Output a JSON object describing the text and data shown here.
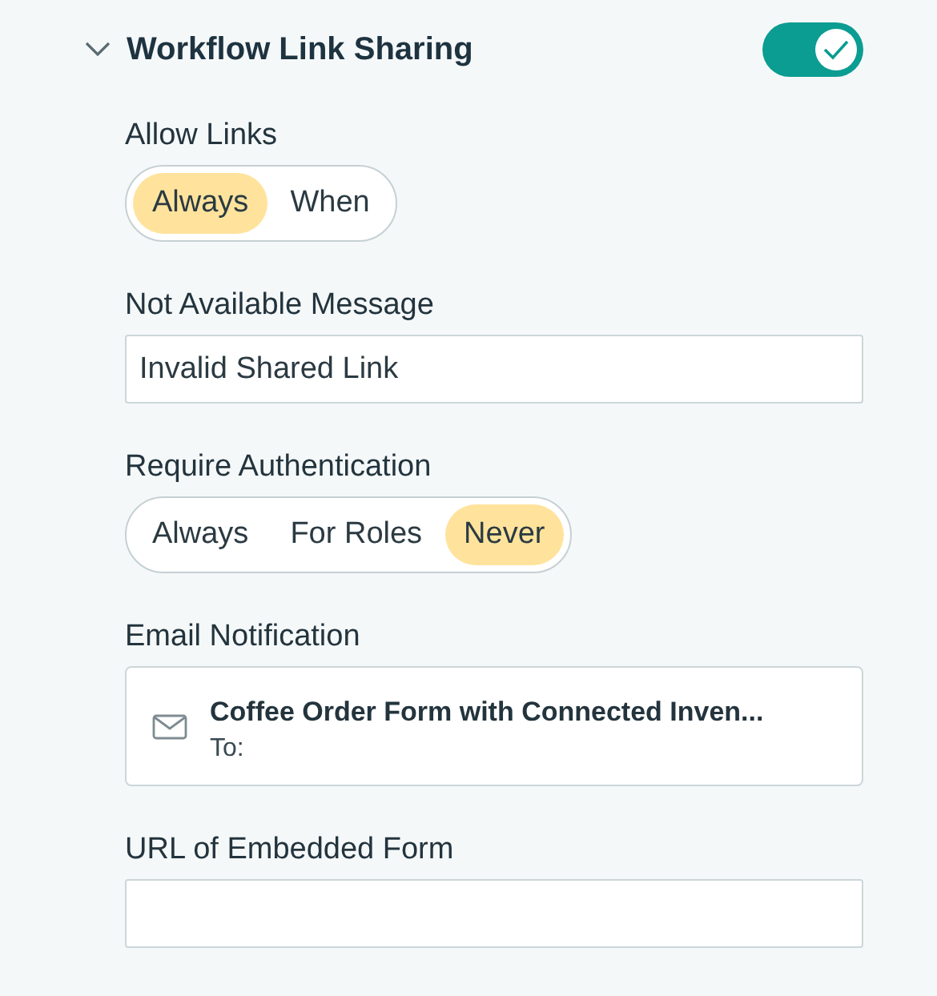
{
  "section": {
    "title": "Workflow Link Sharing",
    "expanded": true,
    "enabled": true
  },
  "fields": [
    {
      "kind": "segmented",
      "label": "Allow Links",
      "options": [
        {
          "label": "Always",
          "selected": true
        },
        {
          "label": "When",
          "selected": false
        }
      ]
    },
    {
      "kind": "text",
      "label": "Not Available Message",
      "value": "Invalid Shared Link"
    },
    {
      "kind": "segmented",
      "label": "Require Authentication",
      "options": [
        {
          "label": "Always",
          "selected": false
        },
        {
          "label": "For Roles",
          "selected": false
        },
        {
          "label": "Never",
          "selected": true
        }
      ]
    },
    {
      "kind": "email",
      "label": "Email Notification",
      "subject": "Coffee Order Form with Connected Inven...",
      "to": "To:"
    },
    {
      "kind": "text",
      "label": "URL of Embedded Form"
    }
  ]
}
